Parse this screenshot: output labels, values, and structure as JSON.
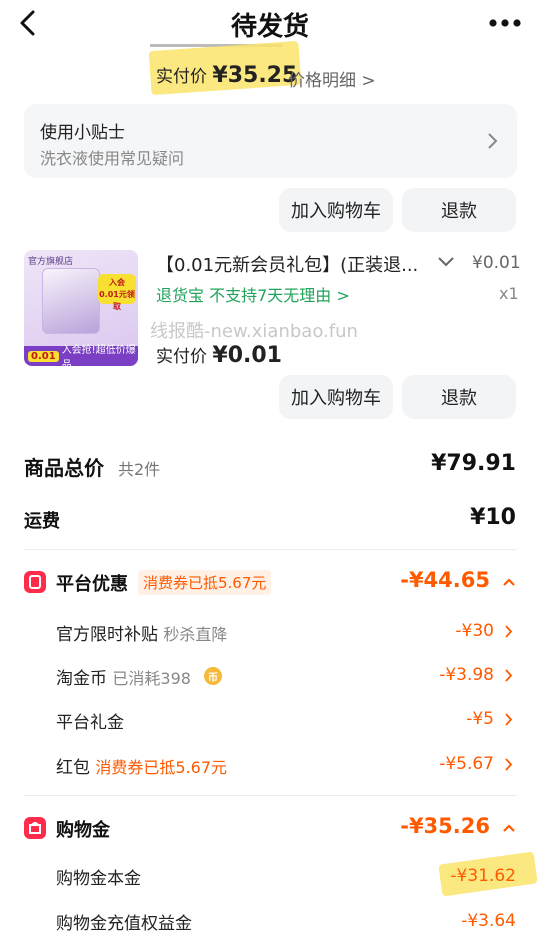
{
  "header": {
    "title": "待发货"
  },
  "order_top": {
    "paid_label": "实付价",
    "paid_value": "¥35.25",
    "detail_link": "价格明细 >"
  },
  "tips": {
    "title": "使用小贴士",
    "subtitle": "洗衣液使用常见疑问"
  },
  "buttons": {
    "add_cart": "加入购物车",
    "refund": "退款"
  },
  "product": {
    "thumb_brand": "官方旗舰店",
    "thumb_badge": "入会 0.01元领取",
    "thumb_price": "0.01",
    "thumb_bar_text": "入会抢!超低价爆品",
    "title": "【0.01元新会员礼包】(正装退...",
    "price": "¥0.01",
    "guarantee": "退货宝  不支持7天无理由 >",
    "qty": "x1",
    "watermark": "线报酷-new.xianbao.fun",
    "paid_label": "实付价",
    "paid_value": "¥0.01"
  },
  "totals": {
    "goods_label": "商品总价",
    "goods_count": "共2件",
    "goods_value": "¥79.91",
    "shipping_label": "运费",
    "shipping_value": "¥10"
  },
  "platform": {
    "label": "平台优惠",
    "tag": "消费券已抵5.67元",
    "value": "-¥44.65",
    "rows": [
      {
        "label": "官方限时补贴",
        "sub": "秒杀直降",
        "value": "-¥30"
      },
      {
        "label": "淘金币",
        "sub": "已消耗398",
        "value": "-¥3.98"
      },
      {
        "label": "平台礼金",
        "sub": "",
        "value": "-¥5"
      },
      {
        "label": "红包",
        "sub": "消费券已抵5.67元",
        "value": "-¥5.67"
      }
    ]
  },
  "shopping_money": {
    "label": "购物金",
    "value": "-¥35.26",
    "rows": [
      {
        "label": "购物金本金",
        "value": "-¥31.62"
      },
      {
        "label": "购物金充值权益金",
        "value": "-¥3.64"
      }
    ]
  },
  "colors": {
    "accent": "#ff5a00",
    "brand_red": "#ff2b4a",
    "green": "#21a35a",
    "highlight": "#fbe46a"
  }
}
